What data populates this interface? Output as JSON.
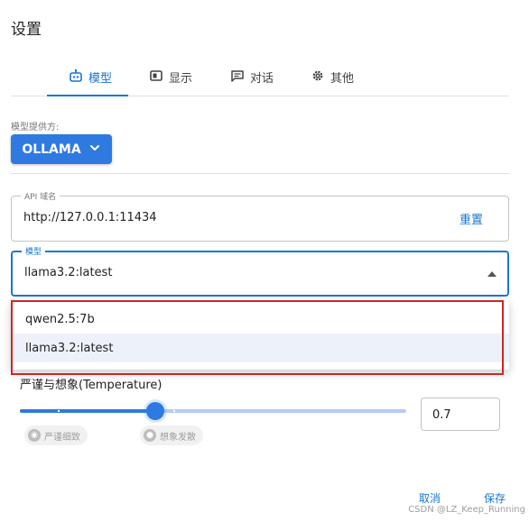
{
  "dialog": {
    "title": "设置"
  },
  "tabs": [
    {
      "label": "模型",
      "icon": "robot-icon",
      "active": true
    },
    {
      "label": "显示",
      "icon": "display-icon",
      "active": false
    },
    {
      "label": "对话",
      "icon": "chat-icon",
      "active": false
    },
    {
      "label": "其他",
      "icon": "gear-icon",
      "active": false
    }
  ],
  "provider": {
    "label": "模型提供方:",
    "value": "OLLAMA"
  },
  "api": {
    "legend": "API 域名",
    "value": "http://127.0.0.1:11434",
    "reset_label": "重置"
  },
  "model": {
    "legend": "模型",
    "value": "llama3.2:latest",
    "options": [
      "qwen2.5:7b",
      "llama3.2:latest"
    ],
    "selected_index": 1
  },
  "temperature": {
    "label": "严谨与想象(Temperature)",
    "value": "0.7",
    "min": 0,
    "max": 2,
    "chip_left": "严谨细致",
    "chip_right": "想象发散"
  },
  "footer": {
    "cancel_label": "取消",
    "save_label": "保存"
  },
  "watermark": "CSDN @LZ_Keep_Running",
  "colors": {
    "accent": "#1976d2",
    "button": "#2f7ae0",
    "highlight_border": "#d22424"
  }
}
